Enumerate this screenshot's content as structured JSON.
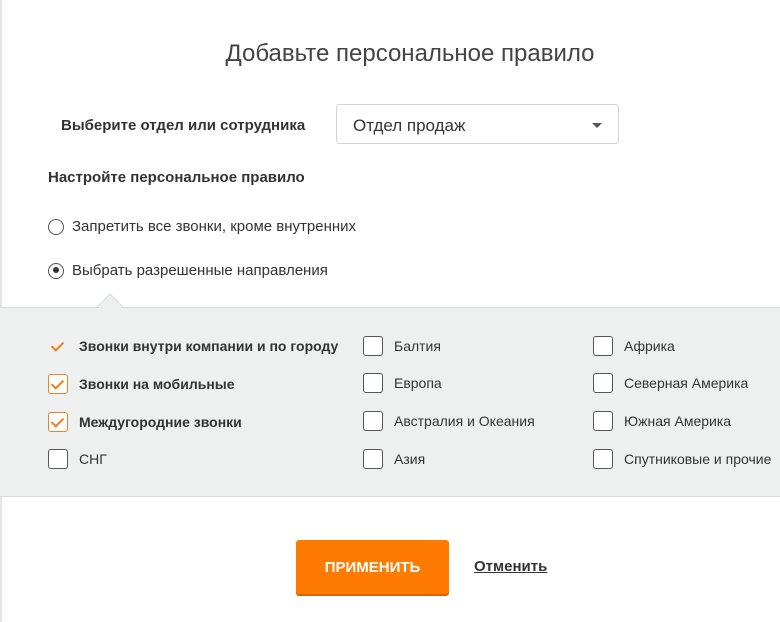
{
  "dialog": {
    "title": "Добавьте персональное правило"
  },
  "selector": {
    "label": "Выберите отдел или сотрудника",
    "value": "Отдел продаж"
  },
  "rule_section": {
    "label": "Настройте персональное правило",
    "radios": [
      {
        "label": "Запретить все звонки, кроме внутренних",
        "checked": false
      },
      {
        "label": "Выбрать разрешенные направления",
        "checked": true
      }
    ]
  },
  "destinations": {
    "col1": [
      {
        "label": "Звонки внутри компании и по городу",
        "checked": true,
        "locked": true
      },
      {
        "label": "Звонки на мобильные",
        "checked": true
      },
      {
        "label": "Междугородние звонки",
        "checked": true
      },
      {
        "label": "СНГ",
        "checked": false
      }
    ],
    "col2": [
      {
        "label": "Балтия",
        "checked": false
      },
      {
        "label": "Европа",
        "checked": false
      },
      {
        "label": "Австралия и Океания",
        "checked": false
      },
      {
        "label": "Азия",
        "checked": false
      }
    ],
    "col3": [
      {
        "label": "Африка",
        "checked": false
      },
      {
        "label": "Северная Америка",
        "checked": false
      },
      {
        "label": "Южная Америка",
        "checked": false
      },
      {
        "label": "Спутниковые и прочие",
        "checked": false
      }
    ]
  },
  "actions": {
    "apply_label": "ПРИМЕНИТЬ",
    "cancel_label": "Отменить"
  },
  "colors": {
    "accent": "#ff7a00",
    "panel_bg": "#eef0f0"
  }
}
